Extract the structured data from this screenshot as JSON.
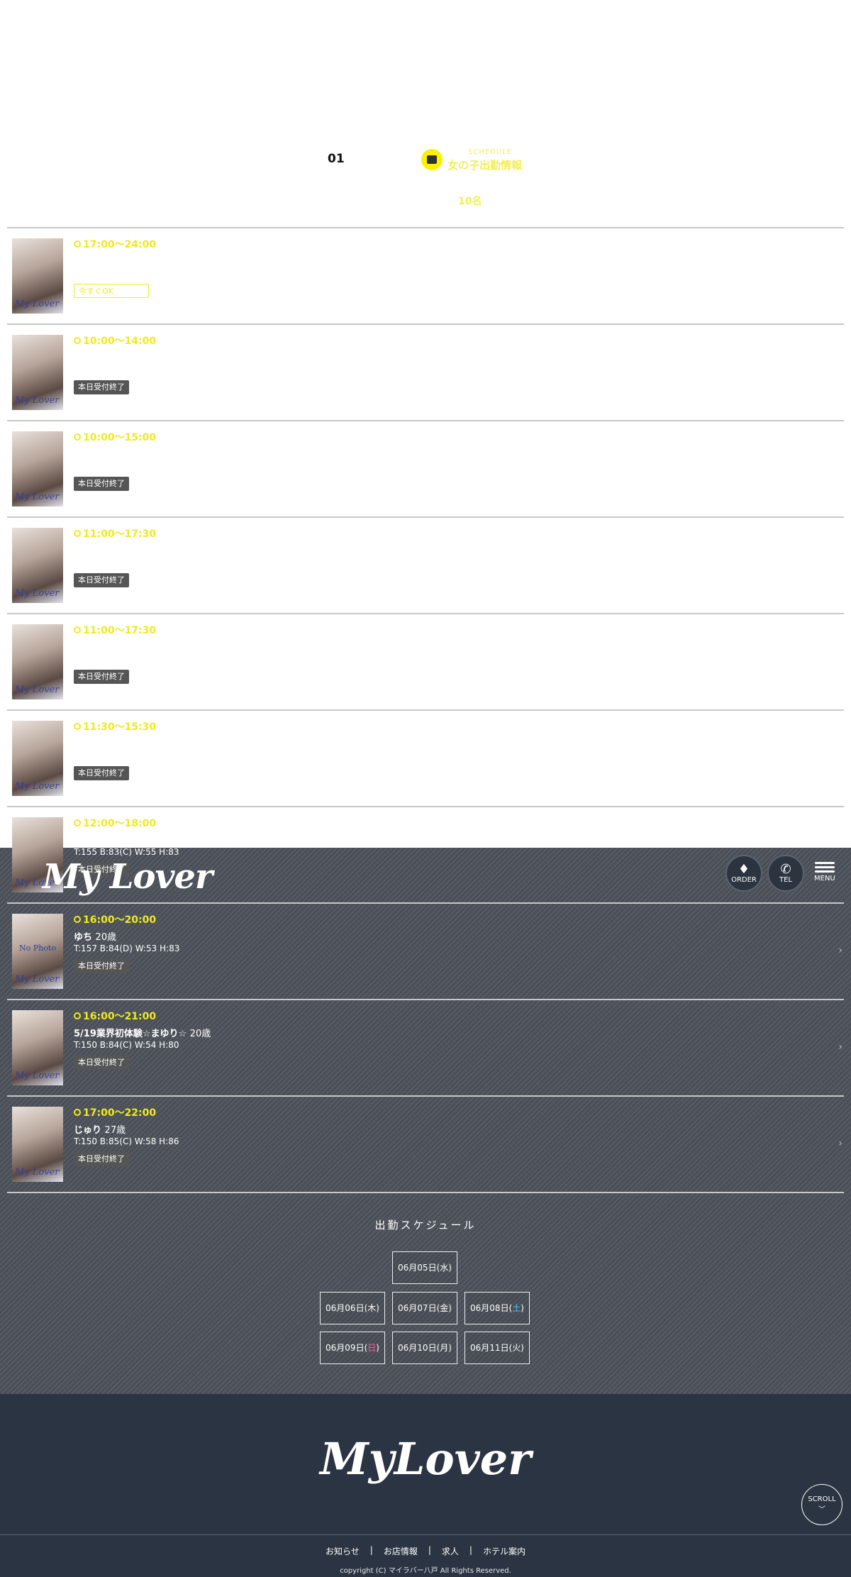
{
  "header": {
    "order_label": "ORDER",
    "tel_label": "TEL",
    "menu_label": "MENU",
    "logo_text": "My Lover"
  },
  "title": {
    "date_number": "01",
    "schedule_en": "SCHEDULE",
    "schedule_jp": "女の子出勤情報",
    "count": "10名"
  },
  "rows": [
    {
      "time": "17:00〜24:00",
      "name": "",
      "age": "",
      "meas": "",
      "status": "今すぐOK",
      "ok": true
    },
    {
      "time": "10:00〜14:00",
      "name": "",
      "age": "",
      "meas": "",
      "status": "本日受付終了",
      "ok": false
    },
    {
      "time": "10:00〜15:00",
      "name": "",
      "age": "",
      "meas": "",
      "status": "本日受付終了",
      "ok": false
    },
    {
      "time": "11:00〜17:30",
      "name": "",
      "age": "",
      "meas": "",
      "status": "本日受付終了",
      "ok": false
    },
    {
      "time": "11:00〜17:30",
      "name": "",
      "age": "",
      "meas": "",
      "status": "本日受付終了",
      "ok": false
    },
    {
      "time": "11:30〜15:30",
      "name": "",
      "age": "",
      "meas": "",
      "status": "本日受付終了",
      "ok": false
    },
    {
      "time": "12:00〜18:00",
      "name": "",
      "age": "",
      "meas": "T:155 B:83(C) W:55 H:83",
      "status": "本日受付終了",
      "ok": false
    },
    {
      "time": "16:00〜20:00",
      "name": "ゆち",
      "age": "20歳",
      "meas": "T:157 B:84(D) W:53 H:83",
      "status": "本日受付終了",
      "ok": false,
      "nophoto": "No Photo"
    },
    {
      "time": "16:00〜21:00",
      "name": "5/19業界初体験☆まゆり☆",
      "age": "20歳",
      "meas": "T:150 B:84(C) W:54 H:80",
      "status": "本日受付終了",
      "ok": false
    },
    {
      "time": "17:00〜22:00",
      "name": "じゅり",
      "age": "27歳",
      "meas": "T:150 B:85(C) W:58 H:86",
      "status": "本日受付終了",
      "ok": false
    }
  ],
  "watermark": "My Lover",
  "schedule": {
    "title": "出勤スケジュール",
    "days": [
      {
        "date": "06月05日(",
        "wd": "水",
        "end": ")",
        "kind": ""
      },
      {
        "date": "06月06日(",
        "wd": "木",
        "end": ")",
        "kind": ""
      },
      {
        "date": "06月07日(",
        "wd": "金",
        "end": ")",
        "kind": ""
      },
      {
        "date": "06月08日(",
        "wd": "土",
        "end": ")",
        "kind": "sat"
      },
      {
        "date": "06月09日(",
        "wd": "日",
        "end": ")",
        "kind": "sun"
      },
      {
        "date": "06月10日(",
        "wd": "月",
        "end": ")",
        "kind": ""
      },
      {
        "date": "06月11日(",
        "wd": "火",
        "end": ")",
        "kind": ""
      }
    ]
  },
  "footer": {
    "logo": "MyLover",
    "scroll": "SCROLL",
    "nav": [
      "お知らせ",
      "お店情報",
      "求人",
      "ホテル案内"
    ],
    "copyright": "copyright (C) マイラバー八戸 All Rights Reserved."
  }
}
